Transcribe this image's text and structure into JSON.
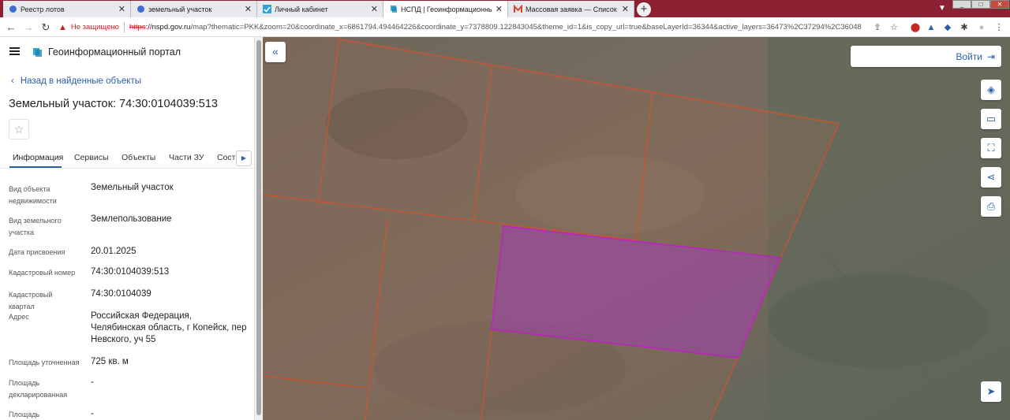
{
  "browser": {
    "tabs": [
      {
        "label": "Реестр лотов",
        "icon": "badge-icon"
      },
      {
        "label": "земельный участок",
        "icon": "badge-icon"
      },
      {
        "label": "Личный кабинет",
        "icon": "checkmark-icon"
      },
      {
        "label": "НСПД | Геоинформационный п",
        "icon": "nspd-icon",
        "active": true
      },
      {
        "label": "Массовая заявка — Список зая",
        "icon": "mail-icon"
      }
    ],
    "new_tab": "+",
    "security_label": "Не защищено",
    "url_scheme": "https",
    "url_host": "://nspd.gov.ru",
    "url_rest": "/map?thematic=PKK&zoom=20&coordinate_x=6861794.494464226&coordinate_y=7378809.122843045&theme_id=1&is_copy_url=true&baseLayerId=36344&active_layers=36473%2C37294%2C36048"
  },
  "portal": {
    "name": "Геоинформационный портал",
    "back_link": "Назад в найденные объекты",
    "object_title": "Земельный участок: 74:30:0104039:513",
    "tabs": [
      "Информация",
      "Сервисы",
      "Объекты",
      "Части ЗУ",
      "Состав"
    ],
    "properties": [
      {
        "label": "Вид объекта недвижимости",
        "value": "Земельный участок"
      },
      {
        "label": "Вид земельного участка",
        "value": "Землепользование"
      },
      {
        "label": "Дата присвоения",
        "value": "20.01.2025"
      },
      {
        "label": "Кадастровый номер",
        "value": "74:30:0104039:513"
      },
      {
        "label": "Кадастровый квартал",
        "value": "74:30:0104039"
      },
      {
        "label": "Адрес",
        "value": "Российская Федерация, Челябинская область, г Копейск, пер Невского, уч 55"
      },
      {
        "label": "Площадь уточненная",
        "value": "725 кв. м"
      },
      {
        "label": "Площадь декларированная",
        "value": "-"
      },
      {
        "label": "Площадь",
        "value": "-"
      }
    ]
  },
  "map": {
    "login_label": "Войти",
    "tools": [
      "layers-icon",
      "ruler-icon",
      "select-area-icon",
      "share-icon",
      "print-icon",
      "locate-icon"
    ],
    "colors": {
      "parcel_border": "#d2522e",
      "selected_fill": "#a040b0",
      "selected_border": "#c020c8"
    }
  }
}
